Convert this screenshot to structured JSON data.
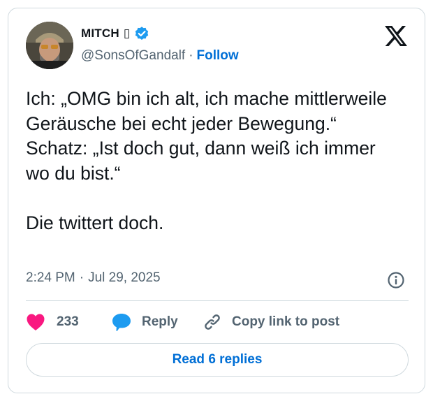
{
  "author": {
    "display_name": "MITCH",
    "name_glyph": "▯",
    "handle": "@SonsOfGandalf",
    "separator": "·",
    "follow_label": "Follow"
  },
  "tweet": {
    "text": "Ich: „OMG bin ich alt, ich mache mittlerweile Geräusche bei echt jeder Bewegung.“\nSchatz: „Ist doch gut, dann weiß ich immer wo du bist.“\n\nDie twittert doch.",
    "time": "2:24 PM",
    "separator": "·",
    "date": "Jul 29, 2025"
  },
  "actions": {
    "like_count": "233",
    "reply_label": "Reply",
    "copy_label": "Copy link to post"
  },
  "read_replies_label": "Read 6 replies",
  "icons": {
    "verified": "verified-badge-icon",
    "logo": "x-logo-icon",
    "info": "info-icon",
    "like": "heart-icon",
    "reply": "speech-bubble-icon",
    "copy": "link-icon"
  },
  "colors": {
    "text": "#0f1419",
    "secondary": "#536471",
    "link": "#006fd6",
    "verified": "#1d9bf0",
    "like": "#f91880",
    "border": "#cfd9de"
  }
}
